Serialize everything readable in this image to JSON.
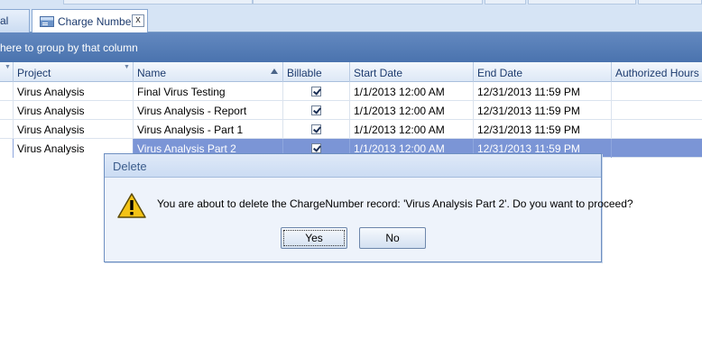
{
  "tabs": {
    "left_tab_label": "al",
    "active_tab_label": "Charge Number",
    "close_label": "x"
  },
  "group_panel": {
    "text": "here to group by that column"
  },
  "grid": {
    "columns": [
      "Project",
      "Name",
      "Billable",
      "Start Date",
      "End Date",
      "Authorized Hours"
    ],
    "rows": [
      {
        "project": "Virus Analysis",
        "name": "Final Virus Testing",
        "billable": true,
        "start": "1/1/2013 12:00 AM",
        "end": "12/31/2013 11:59 PM",
        "hours": ""
      },
      {
        "project": "Virus Analysis",
        "name": "Virus Analysis - Report",
        "billable": true,
        "start": "1/1/2013 12:00 AM",
        "end": "12/31/2013 11:59 PM",
        "hours": ""
      },
      {
        "project": "Virus Analysis",
        "name": "Virus Analysis - Part 1",
        "billable": true,
        "start": "1/1/2013 12:00 AM",
        "end": "12/31/2013 11:59 PM",
        "hours": ""
      },
      {
        "project": "Virus Analysis",
        "name": "Virus Analysis Part 2",
        "billable": true,
        "start": "1/1/2013 12:00 AM",
        "end": "12/31/2013 11:59 PM",
        "hours": "",
        "selected": true
      }
    ]
  },
  "dialog": {
    "title": "Delete",
    "message": "You are about to delete the ChargeNumber record: 'Virus Analysis Part 2'. Do you want to proceed?",
    "yes_label": "Yes",
    "no_label": "No",
    "icon": "warning-icon"
  },
  "colors": {
    "group_panel": "#4f78b3",
    "selected_row": "#7b95d6",
    "dialog_bg": "#eef3fb"
  }
}
